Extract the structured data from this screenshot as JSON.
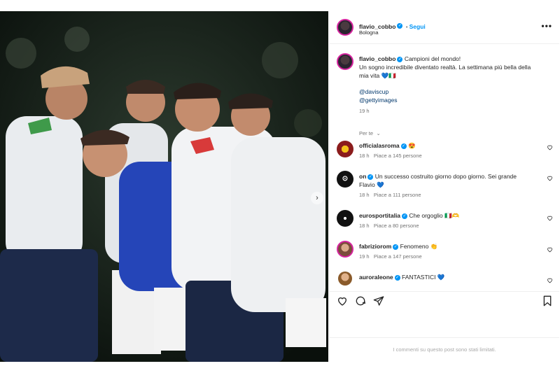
{
  "header": {
    "username": "flavio_cobbo",
    "follow_label": "Segui",
    "location": "Bologna",
    "more_icon": "more-horizontal-icon"
  },
  "caption": {
    "username": "flavio_cobbo",
    "text_line1": "Campioni del mondo!",
    "text_line2": "Un sogno incredibile diventato realtà. La settimana più bella della",
    "text_line3": "mia vita 💙🇮🇹",
    "mention1": "@daviscup",
    "mention2": "@gettyimages",
    "time": "19 h"
  },
  "sort_label": "Per te",
  "comments": [
    {
      "username": "officialasroma",
      "text": "😍",
      "time": "18 h",
      "likes": "Piace a 145 persone"
    },
    {
      "username": "on",
      "text_line1": "Un successo costruito giorno dopo giorno. Sei grande",
      "text_line2": "Flavio 💙",
      "time": "18 h",
      "likes": "Piace a 111 persone"
    },
    {
      "username": "eurosportitalia",
      "text": "Che orgoglio 🇮🇹🫶",
      "time": "18 h",
      "likes": "Piace a 80 persone"
    },
    {
      "username": "fabriziorom",
      "text": "Fenomeno 👏",
      "time": "19 h",
      "likes": "Piace a 147 persone"
    },
    {
      "username": "auroraleone",
      "text": "FANTASTICI 💙"
    }
  ],
  "footer_text": "I commenti su questo post sono stati limitati.",
  "colors": {
    "accent": "#0095f6",
    "link": "#00376b",
    "muted": "#737373"
  }
}
